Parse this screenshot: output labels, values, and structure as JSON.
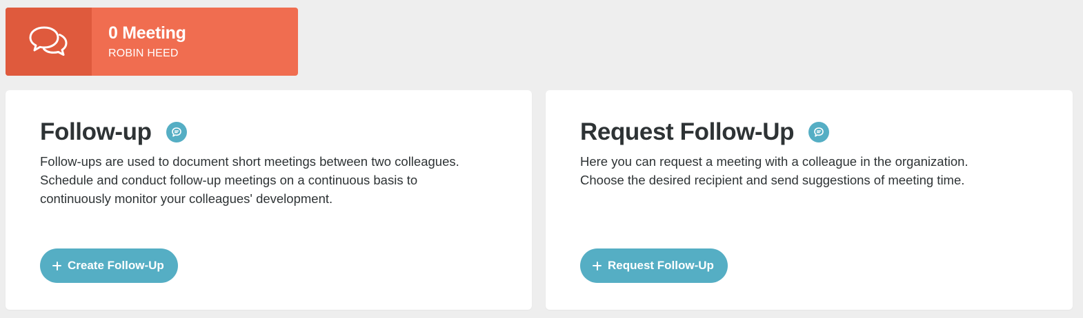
{
  "stat_card": {
    "count_label": "0 Meeting",
    "user_name": "ROBIN HEED",
    "icon": "chat-bubbles-icon",
    "color": "#f06d50",
    "icon_bg_color": "#df5a3d"
  },
  "follow_up": {
    "title": "Follow-up",
    "info_icon": "comment-icon",
    "description_lines": [
      "Follow-ups are used to document short meetings between two colleagues.",
      "Schedule and conduct follow-up meetings on a continuous basis to",
      "continuously monitor your colleagues' development."
    ],
    "button_label": "Create Follow-Up",
    "button_icon": "plus-icon"
  },
  "request_follow_up": {
    "title": "Request Follow-Up",
    "info_icon": "comment-icon",
    "description_lines": [
      "Here you can request a meeting with a colleague in the organization.",
      "Choose the desired recipient and send suggestions of meeting time."
    ],
    "button_label": "Request Follow-Up",
    "button_icon": "plus-icon"
  },
  "colors": {
    "accent": "#55aec4",
    "page_background": "#eeeeee",
    "text": "#2e3335"
  }
}
